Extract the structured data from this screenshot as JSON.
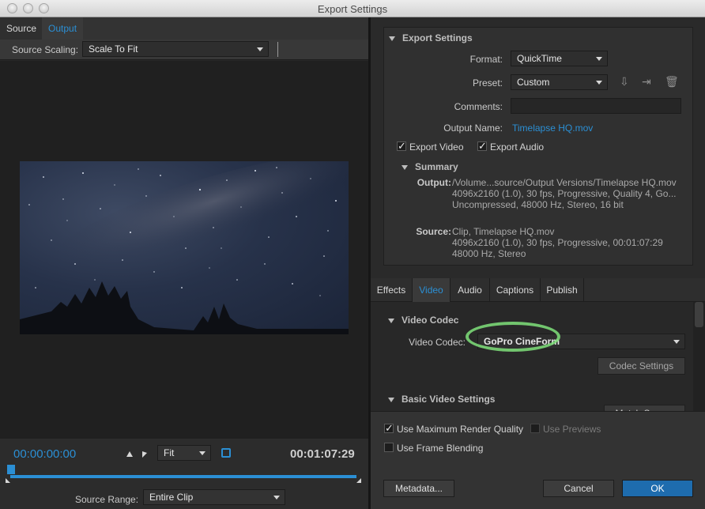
{
  "window": {
    "title": "Export Settings"
  },
  "left": {
    "tabs": [
      "Source",
      "Output"
    ],
    "source_scaling_label": "Source Scaling:",
    "source_scaling_value": "Scale To Fit",
    "timecode_start": "00:00:00:00",
    "timecode_end": "00:01:07:29",
    "zoom_value": "Fit",
    "source_range_label": "Source Range:",
    "source_range_value": "Entire Clip"
  },
  "export": {
    "section_title": "Export Settings",
    "format_label": "Format:",
    "format_value": "QuickTime",
    "preset_label": "Preset:",
    "preset_value": "Custom",
    "comments_label": "Comments:",
    "comments_value": "",
    "output_name_label": "Output Name:",
    "output_name_value": "Timelapse HQ.mov",
    "export_video_label": "Export Video",
    "export_audio_label": "Export Audio",
    "summary_title": "Summary",
    "output_label": "Output:",
    "output_lines": [
      "/Volume...source/Output Versions/Timelapse HQ.mov",
      "4096x2160 (1.0), 30 fps, Progressive, Quality 4, Go...",
      "Uncompressed, 48000 Hz, Stereo, 16 bit"
    ],
    "source_label": "Source:",
    "source_lines": [
      "Clip, Timelapse HQ.mov",
      "4096x2160 (1.0), 30 fps, Progressive, 00:01:07:29",
      "48000 Hz, Stereo"
    ]
  },
  "tabs": [
    "Effects",
    "Video",
    "Audio",
    "Captions",
    "Publish"
  ],
  "video": {
    "codec_section": "Video Codec",
    "codec_label": "Video Codec:",
    "codec_value": "GoPro CineForm",
    "codec_settings_btn": "Codec Settings",
    "basic_section": "Basic Video Settings",
    "match_source_btn": "Match Source"
  },
  "bottom": {
    "max_render_quality": "Use Maximum Render Quality",
    "use_previews": "Use Previews",
    "frame_blending": "Use Frame Blending",
    "metadata_btn": "Metadata...",
    "cancel_btn": "Cancel",
    "ok_btn": "OK"
  }
}
